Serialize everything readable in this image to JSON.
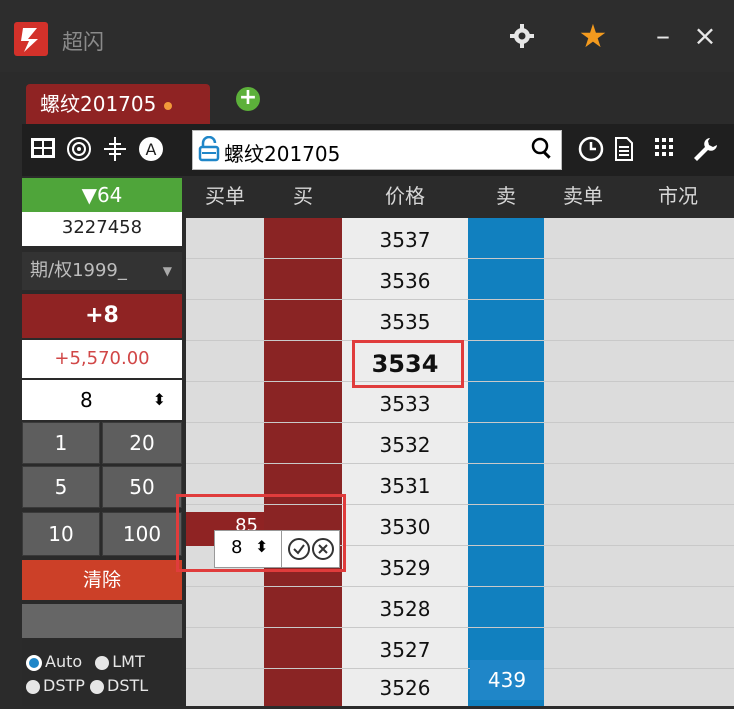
{
  "app": {
    "title": "超闪",
    "settings_icon": "gear-icon",
    "star_icon": "star-icon",
    "min_label": "–",
    "close_label": "×"
  },
  "tabs": [
    {
      "label": "螺纹201705",
      "active": true
    }
  ],
  "toolbar": {
    "contract": "螺纹201705",
    "icons": [
      "grid-icon",
      "target-icon",
      "crosshair-icon",
      "auto-icon",
      "lock-icon",
      "search-icon",
      "clock-icon",
      "document-icon",
      "keypad-icon",
      "wrench-icon"
    ],
    "auto_label": "A"
  },
  "left": {
    "change_label": "▼64",
    "volume": "3227458",
    "account": "期/权1999_",
    "position": "+8",
    "pnl": "+5,570.00",
    "qty": "8",
    "qty_buttons": [
      "1",
      "20",
      "5",
      "50",
      "10",
      "100"
    ],
    "clear_label": "清除",
    "radio": [
      {
        "label": "Auto",
        "checked": true
      },
      {
        "label": "LMT",
        "checked": false
      },
      {
        "label": "DSTP",
        "checked": false
      },
      {
        "label": "DSTL",
        "checked": false
      }
    ]
  },
  "grid": {
    "headers": [
      "买单",
      "买",
      "价格",
      "卖",
      "卖单",
      "市况"
    ],
    "prices": [
      "3537",
      "3536",
      "3535",
      "3534",
      "3533",
      "3532",
      "3531",
      "3530",
      "3529",
      "3528",
      "3527",
      "3526"
    ],
    "last_price": "3534",
    "buy_order_qty": "85",
    "sell_qty_bottom": "439",
    "popup_qty": "8"
  },
  "colors": {
    "buy": "#8f2323",
    "sell": "#1f86c8",
    "accent": "#e03c3c",
    "green": "#4fa53a"
  }
}
